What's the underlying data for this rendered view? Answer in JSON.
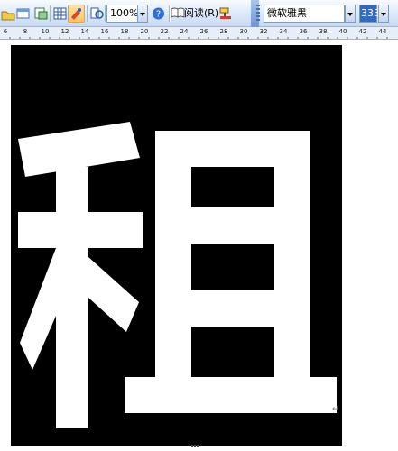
{
  "toolbar": {
    "zoom": "100%",
    "read_label": "阅读(R)",
    "font_name": "微软雅黑",
    "font_size": "333",
    "accent_color": "#316ac5",
    "icons": [
      "open-icon",
      "print-preview-icon",
      "spelling-icon",
      "table-icon",
      "drawing-icon",
      "document-map-icon",
      "help-icon",
      "read-icon",
      "format-painter-icon"
    ]
  },
  "ruler": {
    "labels": [
      "6",
      "8",
      "10",
      "12",
      "14",
      "16",
      "18",
      "20",
      "22",
      "24",
      "26",
      "28",
      "30",
      "32",
      "34",
      "36",
      "38",
      "40",
      "42",
      "44"
    ]
  },
  "document": {
    "big_character": "租",
    "background_color": "#000000",
    "text_color": "#ffffff",
    "paragraph_mark": "↵"
  }
}
